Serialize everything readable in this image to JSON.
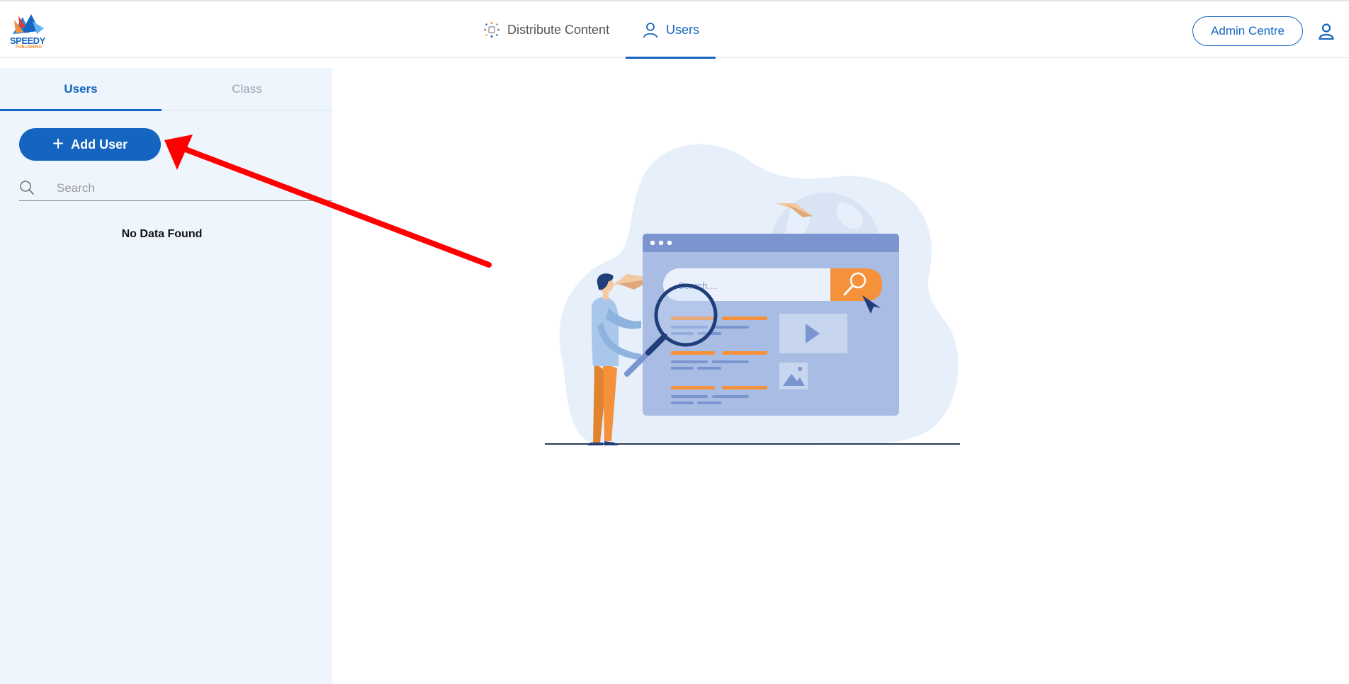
{
  "header": {
    "logo_text": "SPEEDY",
    "logo_subtext": "PUBLISHING",
    "nav": [
      {
        "label": "Distribute Content",
        "icon": "distribute-icon"
      },
      {
        "label": "Users",
        "icon": "user-icon",
        "active": true
      }
    ],
    "admin_button": "Admin Centre",
    "profile_icon": "profile-icon"
  },
  "sidebar": {
    "tabs": [
      {
        "label": "Users",
        "active": true
      },
      {
        "label": "Class",
        "active": false
      }
    ],
    "add_user_label": "Add User",
    "search_placeholder": "Search",
    "empty_message": "No Data Found"
  },
  "illustration": {
    "search_placeholder": "Search...."
  },
  "colors": {
    "primary": "#1565c0",
    "sidebar_bg": "#eef5fd",
    "accent_orange": "#f5913a",
    "annotation_arrow": "#ff0000"
  }
}
